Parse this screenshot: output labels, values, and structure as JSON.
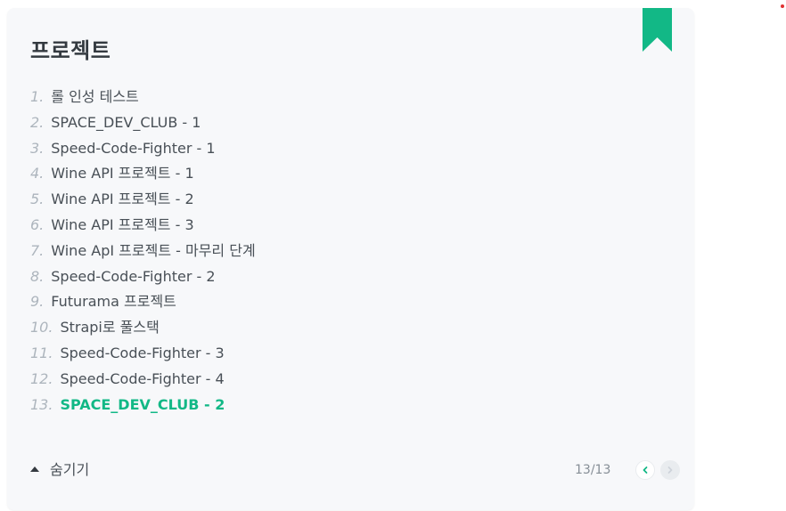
{
  "series": {
    "title": "프로젝트",
    "items": [
      {
        "num": "1.",
        "label": "롤 인성 테스트"
      },
      {
        "num": "2.",
        "label": "SPACE_DEV_CLUB - 1"
      },
      {
        "num": "3.",
        "label": "Speed-Code-Fighter - 1"
      },
      {
        "num": "4.",
        "label": "Wine API 프로젝트 - 1"
      },
      {
        "num": "5.",
        "label": "Wine API 프로젝트 - 2"
      },
      {
        "num": "6.",
        "label": "Wine API 프로젝트 - 3"
      },
      {
        "num": "7.",
        "label": "Wine ApI 프로젝트 - 마무리 단계"
      },
      {
        "num": "8.",
        "label": "Speed-Code-Fighter - 2"
      },
      {
        "num": "9.",
        "label": "Futurama 프로젝트"
      },
      {
        "num": "10.",
        "label": "Strapi로 풀스택"
      },
      {
        "num": "11.",
        "label": "Speed-Code-Fighter - 3"
      },
      {
        "num": "12.",
        "label": "Speed-Code-Fighter - 4"
      },
      {
        "num": "13.",
        "label": "SPACE_DEV_CLUB - 2"
      }
    ],
    "active_index": 12,
    "toggle_label": "숨기기",
    "page_indicator": "13/13"
  },
  "icons": {
    "bookmark": "bookmark-icon",
    "toggle": "caret-up-icon",
    "prev": "chevron-left-icon",
    "next": "chevron-right-icon"
  },
  "colors": {
    "accent": "#12b886",
    "card_bg": "#f7f8fa",
    "text": "#495057",
    "muted": "#adb5bd",
    "dot": "#e03131"
  }
}
